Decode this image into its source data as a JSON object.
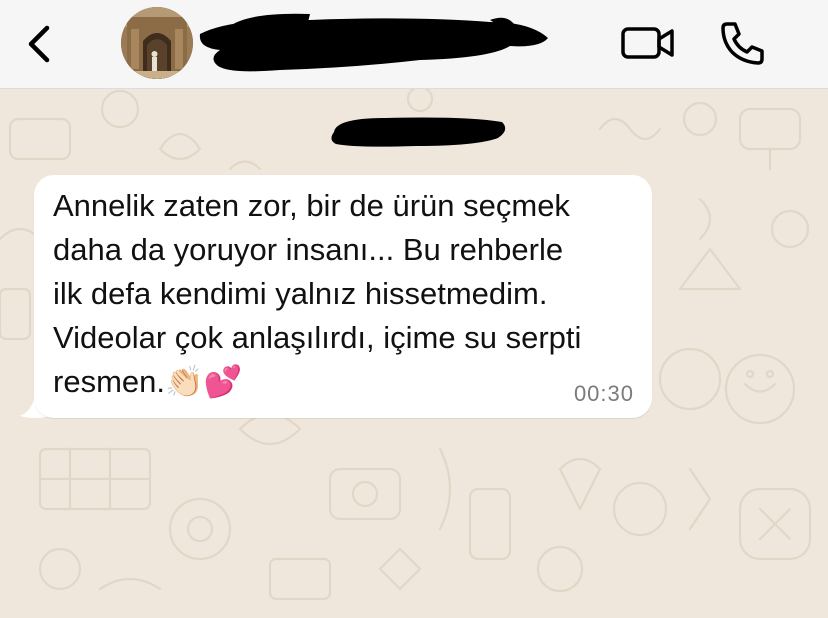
{
  "header": {
    "back_icon": "chevron-left-icon",
    "video_icon": "video-camera-icon",
    "call_icon": "phone-icon"
  },
  "message": {
    "lines": [
      "Annelik zaten zor, bir de ürün seçmek",
      "daha da yoruyor insanı... Bu rehberle",
      "ilk defa kendimi yalnız hissetmedim.",
      "Videolar çok anlaşılırdı, içime su serpti",
      "resmen."
    ],
    "emojis": "👏🏻💕",
    "time": "00:30"
  },
  "colors": {
    "chat_background": "#efe7dc",
    "header_background": "#f6f6f6",
    "bubble": "#ffffff",
    "icon": "#000000",
    "timestamp": "#7b7b7b"
  }
}
